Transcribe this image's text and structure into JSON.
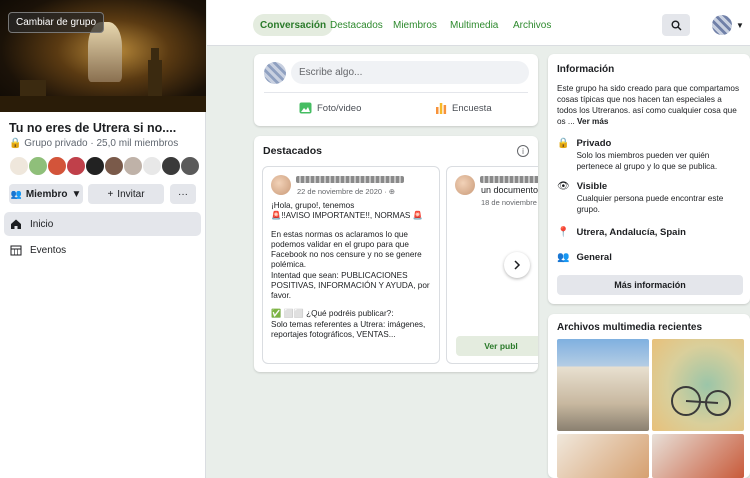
{
  "sidebar": {
    "cover_button": "Cambiar de grupo",
    "group_name": "Tu no eres de Utrera si no....",
    "privacy": "Grupo privado",
    "members_count": "25,0 mil miembros",
    "member_button": "Miembro",
    "invite_button": "Invitar",
    "more_button": "···",
    "nav": [
      {
        "label": "Inicio",
        "icon": "home-icon"
      },
      {
        "label": "Eventos",
        "icon": "calendar-icon"
      }
    ]
  },
  "header": {
    "tabs": [
      "Conversación",
      "Destacados",
      "Miembros",
      "Multimedia",
      "Archivos"
    ],
    "active_tab": "Conversación"
  },
  "composer": {
    "placeholder": "Escribe algo...",
    "photo_label": "Foto/video",
    "poll_label": "Encuesta"
  },
  "featured": {
    "title": "Destacados",
    "post1": {
      "date": "22 de noviembre de 2020",
      "lines": [
        "¡Hola, grupo!, tenemos",
        "🚨!!AVISO IMPORTANTE!!, NORMAS 🚨",
        "En estas normas os aclaramos lo que podemos validar en el grupo para que Facebook no nos censure y no se genere polémica.",
        "Intentad que sean: PUBLICACIONES POSITIVAS, INFORMACIÓN Y AYUDA, por favor.",
        "✅ ⬜⬜ ¿Qué podréis publicar?:",
        "Solo temas referentes a Utrera: imágenes, reportajes fotográficos, VENTAS..."
      ]
    },
    "post2": {
      "subtitle": "un documento",
      "date": "18 de noviembre"
    },
    "view_post_button": "Ver publ"
  },
  "info": {
    "title": "Información",
    "description": "Este grupo ha sido creado para que compartamos cosas típicas que nos hacen tan especiales a todos los Utreranos. así como cualquier cosa que os ...",
    "see_more": "Ver más",
    "private_title": "Privado",
    "private_desc": "Solo los miembros pueden ver quién pertenece al grupo y lo que se publica.",
    "visible_title": "Visible",
    "visible_desc": "Cualquier persona puede encontrar este grupo.",
    "location": "Utrera, Andalucía, Spain",
    "category": "General",
    "more_info_button": "Más información"
  },
  "media": {
    "title": "Archivos multimedia recientes"
  },
  "colors": {
    "accent_green": "#2e8a2e",
    "background": "#e9eeea"
  }
}
